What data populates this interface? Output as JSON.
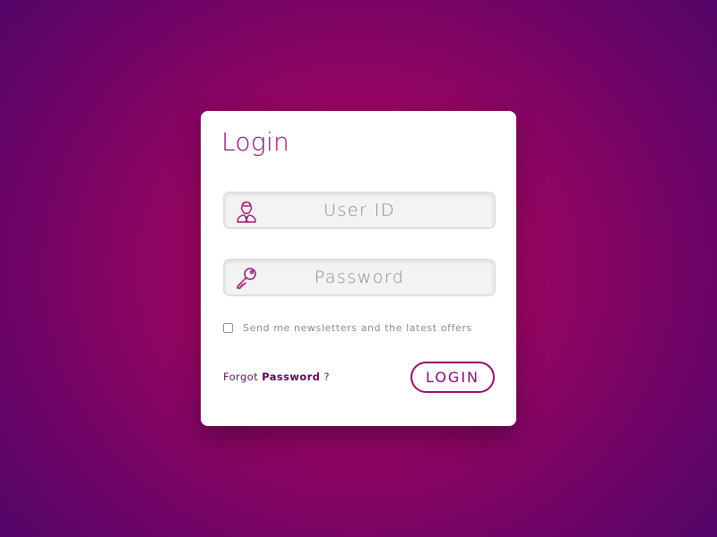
{
  "login": {
    "title": "Login",
    "user_id": {
      "placeholder": "User ID",
      "value": "",
      "icon": "user-icon"
    },
    "password": {
      "placeholder": "Password",
      "value": "",
      "icon": "key-icon"
    },
    "newsletter": {
      "label": "Send me newsletters and the latest offers",
      "checked": false
    },
    "forgot": {
      "prefix": "Forgot",
      "emphasis": "Password",
      "suffix": "?"
    },
    "submit_label": "LOGIN"
  },
  "colors": {
    "accent": "#8a0c6e",
    "background_center": "#b0065a",
    "background_edge": "#520569"
  }
}
